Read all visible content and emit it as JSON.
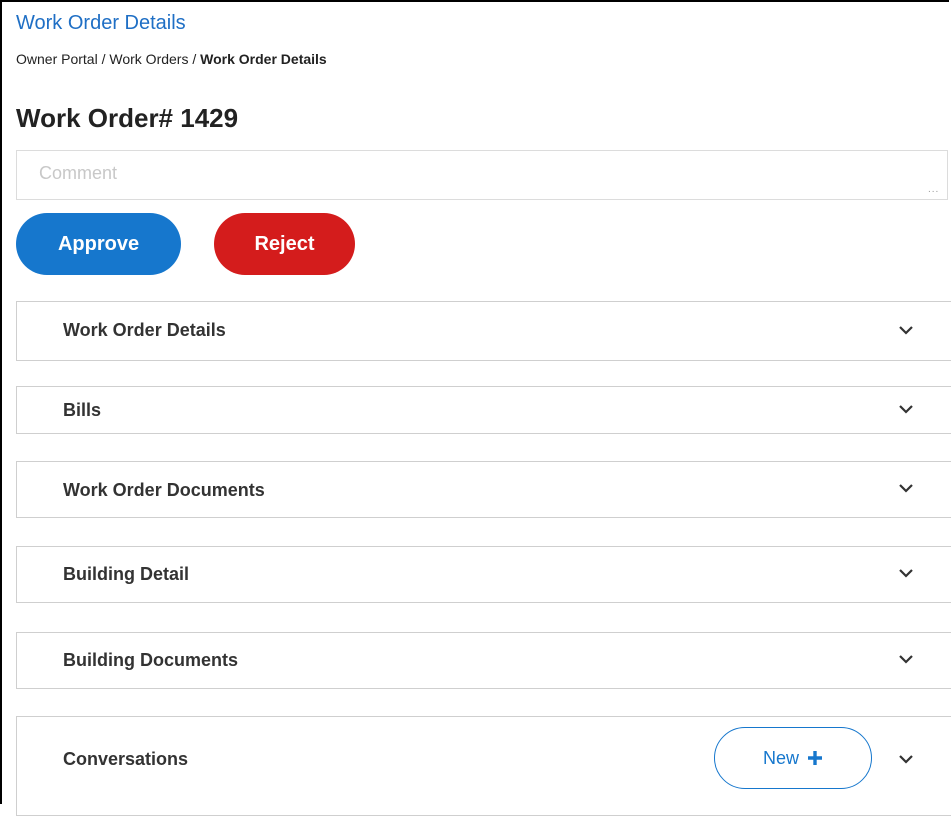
{
  "header": {
    "page_heading": "Work Order Details",
    "breadcrumb": {
      "owner_portal": "Owner Portal",
      "separator": " / ",
      "work_orders": "Work Orders",
      "current": "Work Order Details"
    },
    "work_order_title": "Work Order# 1429"
  },
  "comment": {
    "placeholder": "Comment",
    "value": ""
  },
  "actions": {
    "approve_label": "Approve",
    "reject_label": "Reject"
  },
  "panels": [
    {
      "label": "Work Order Details"
    },
    {
      "label": "Bills"
    },
    {
      "label": "Work Order Documents"
    },
    {
      "label": "Building Detail"
    },
    {
      "label": "Building Documents"
    },
    {
      "label": "Conversations",
      "new_button_label": "New"
    }
  ],
  "colors": {
    "accent": "#1677cd",
    "approve": "#1677cd",
    "reject": "#d41c1c",
    "heading_link": "#1f6fc5"
  },
  "icons": {
    "panel_toggle": "chevron-down-icon",
    "new_button": "plus-icon"
  }
}
